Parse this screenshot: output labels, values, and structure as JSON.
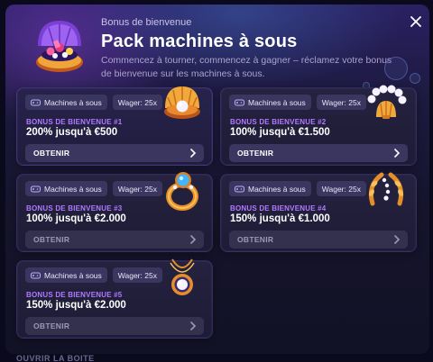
{
  "header": {
    "subtitle": "Bonus de bienvenue",
    "title": "Pack machines à sous",
    "description": "Commencez à tourner, commencez à gagner – réclamez votre bonus de bienvenue sur les machines à sous."
  },
  "cards": [
    {
      "category": "Machines à sous",
      "wager": "Wager: 25x",
      "label": "BONUS DE BIENVENUE #1",
      "value": "200% jusqu'à €500",
      "button": "OBTENIR",
      "art": "pearl-shell-icon"
    },
    {
      "category": "Machines à sous",
      "wager": "Wager: 25x",
      "label": "BONUS DE BIENVENUE #2",
      "value": "100% jusqu'à €1.500",
      "button": "OBTENIR",
      "art": "pearl-bracelet-icon"
    },
    {
      "category": "Machines à sous",
      "wager": "Wager: 25x",
      "label": "BONUS DE BIENVENUE #3",
      "value": "100% jusqu'à €2.000",
      "button": "OBTENIR",
      "art": "diamond-ring-icon"
    },
    {
      "category": "Machines à sous",
      "wager": "Wager: 25x",
      "label": "BONUS DE BIENVENUE #4",
      "value": "150% jusqu'à €1.000",
      "button": "OBTENIR",
      "art": "pearl-wreath-icon"
    },
    {
      "category": "Machines à sous",
      "wager": "Wager: 25x",
      "label": "BONUS DE BIENVENUE #5",
      "value": "150% jusqu'à €2.000",
      "button": "OBTENIR",
      "art": "pearl-pendant-icon"
    }
  ],
  "footer": {
    "text": "OUVRIR LA BOITE"
  },
  "colors": {
    "accent": "#b07aff",
    "card_bg": "#27234c",
    "button_bg": "#3a3660",
    "gold": "#f2a93b"
  }
}
